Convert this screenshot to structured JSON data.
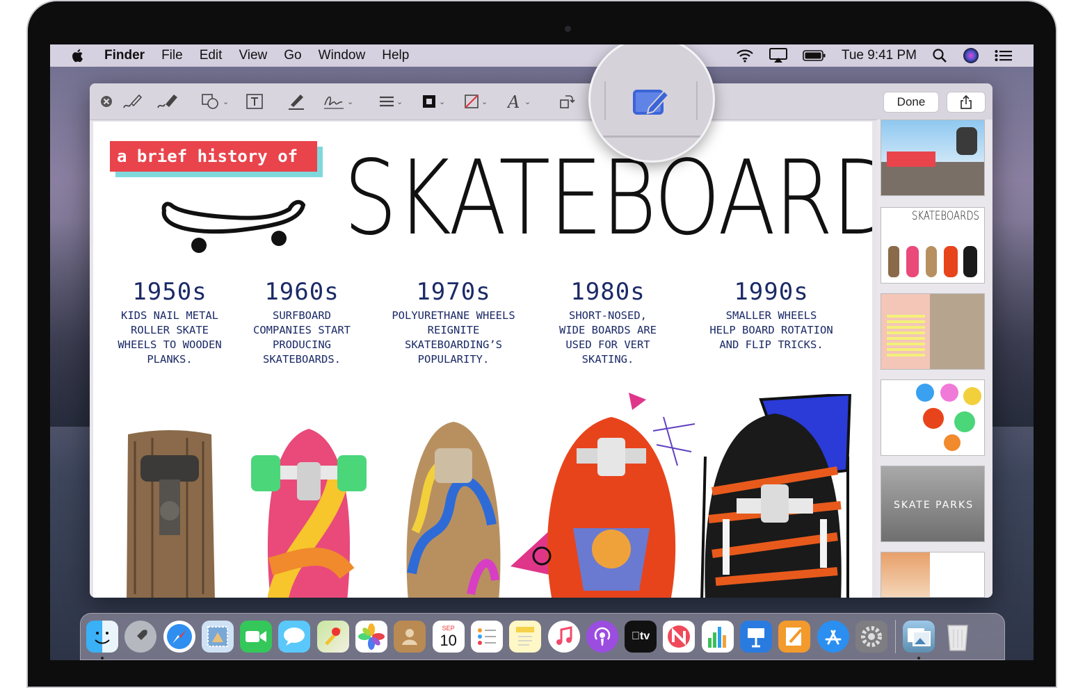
{
  "menubar": {
    "apple_icon": "apple-logo",
    "items": [
      "Finder",
      "File",
      "Edit",
      "View",
      "Go",
      "Window",
      "Help"
    ],
    "clock": "Tue 9:41 PM",
    "status_icons": [
      "wifi-icon",
      "airplay-icon",
      "battery-icon",
      "spotlight-icon",
      "siri-icon",
      "control-center-icon"
    ]
  },
  "toolbar": {
    "done_label": "Done",
    "tools": [
      "close",
      "sketch",
      "draw",
      "shapes",
      "text",
      "highlight",
      "sign",
      "line-style",
      "border-color",
      "fill-color",
      "text-style",
      "rotate"
    ],
    "highlighted_tool": "edit-with-iphone-ipad"
  },
  "document": {
    "banner": "a brief history of",
    "title": "SKATEBOARDS",
    "decades": [
      {
        "year": "1950s",
        "text": [
          "KIDS NAIL METAL",
          "ROLLER SKATE",
          "WHEELS TO WOODEN",
          "PLANKS."
        ]
      },
      {
        "year": "1960s",
        "text": [
          "SURFBOARD",
          "COMPANIES START",
          "PRODUCING",
          "SKATEBOARDS."
        ]
      },
      {
        "year": "1970s",
        "text": [
          "POLYURETHANE WHEELS",
          "REIGNITE",
          "SKATEBOARDING’S",
          "POPULARITY."
        ]
      },
      {
        "year": "1980s",
        "text": [
          "SHORT-NOSED,",
          "WIDE BOARDS ARE",
          "USED FOR VERT",
          "SKATING."
        ]
      },
      {
        "year": "1990s",
        "text": [
          "SMALLER WHEELS",
          "HELP BOARD ROTATION",
          "AND FLIP TRICKS."
        ]
      }
    ]
  },
  "thumbnails": {
    "thumb2_title": "SKATEBOARDS",
    "thumb5_title": "SKATE PARKS"
  },
  "dock": {
    "calendar_month": "SEP",
    "calendar_day": "10",
    "tv_label": "tv",
    "apps": [
      "finder",
      "launchpad",
      "safari",
      "mail",
      "facetime",
      "messages",
      "maps",
      "photos",
      "contacts",
      "calendar",
      "reminders",
      "notes",
      "music",
      "podcasts",
      "tv",
      "news",
      "numbers",
      "keynote",
      "pages",
      "app-store",
      "system-preferences",
      "preview",
      "trash"
    ]
  },
  "colors": {
    "banner_red": "#e9434c",
    "banner_shadow": "#7fd9dc",
    "decade_blue": "#1b2a67",
    "highlight_blue": "#3b64d8"
  }
}
